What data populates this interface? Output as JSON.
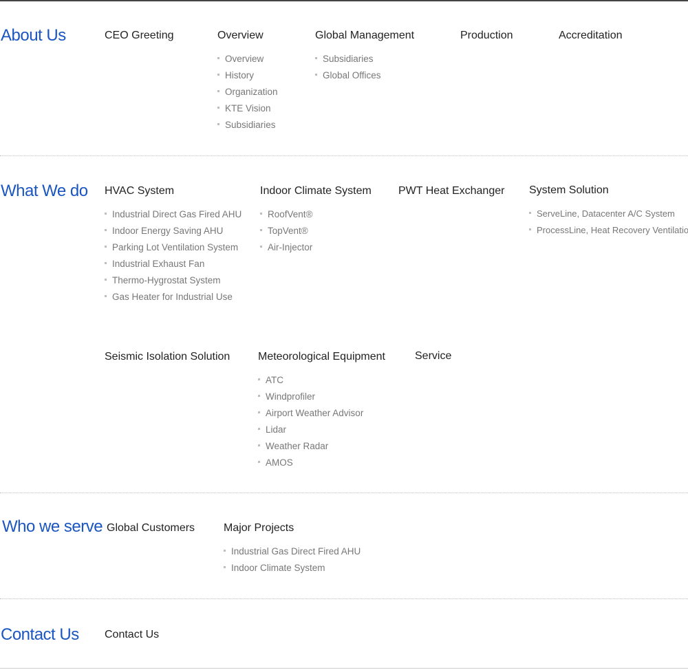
{
  "colors": {
    "accent": "#1b56c0",
    "heading": "#222222",
    "item": "#777777",
    "bullet": "#bdbdbd"
  },
  "about": {
    "title": "About Us",
    "ceo": "CEO Greeting",
    "overview": {
      "label": "Overview",
      "items": [
        "Overview",
        "History",
        "Organization",
        "KTE Vision",
        "Subsidiaries"
      ]
    },
    "global": {
      "label": "Global Management",
      "items": [
        "Subsidiaries",
        "Global Offices"
      ]
    },
    "production": "Production",
    "accreditation": "Accreditation"
  },
  "whatwedo": {
    "title": "What We do",
    "hvac": {
      "label": "HVAC System",
      "items": [
        "Industrial Direct Gas Fired AHU",
        "Indoor Energy Saving AHU",
        "Parking Lot Ventilation System",
        "Industrial Exhaust Fan",
        "Thermo-Hygrostat System",
        "Gas Heater for Industrial Use"
      ]
    },
    "indoor": {
      "label": "Indoor Climate System",
      "items": [
        "RoofVent®",
        "TopVent®",
        "Air-Injector"
      ]
    },
    "pwt": "PWT Heat Exchanger",
    "system": {
      "label": "System Solution",
      "items": [
        "ServeLine, Datacenter A/C System",
        "ProcessLine, Heat Recovery Ventilation"
      ]
    },
    "seismic": "Seismic Isolation Solution",
    "meteo": {
      "label": "Meteorological Equipment",
      "items": [
        "ATC",
        "Windprofiler",
        "Airport Weather Advisor",
        "Lidar",
        "Weather Radar",
        "AMOS"
      ]
    },
    "service": "Service"
  },
  "whoweserve": {
    "title": "Who we serve",
    "global_customers": "Global Customers",
    "projects": {
      "label": "Major Projects",
      "items": [
        "Industrial Gas Direct Fired AHU",
        "Indoor Climate System"
      ]
    }
  },
  "contact": {
    "title": "Contact Us",
    "link": "Contact Us"
  }
}
